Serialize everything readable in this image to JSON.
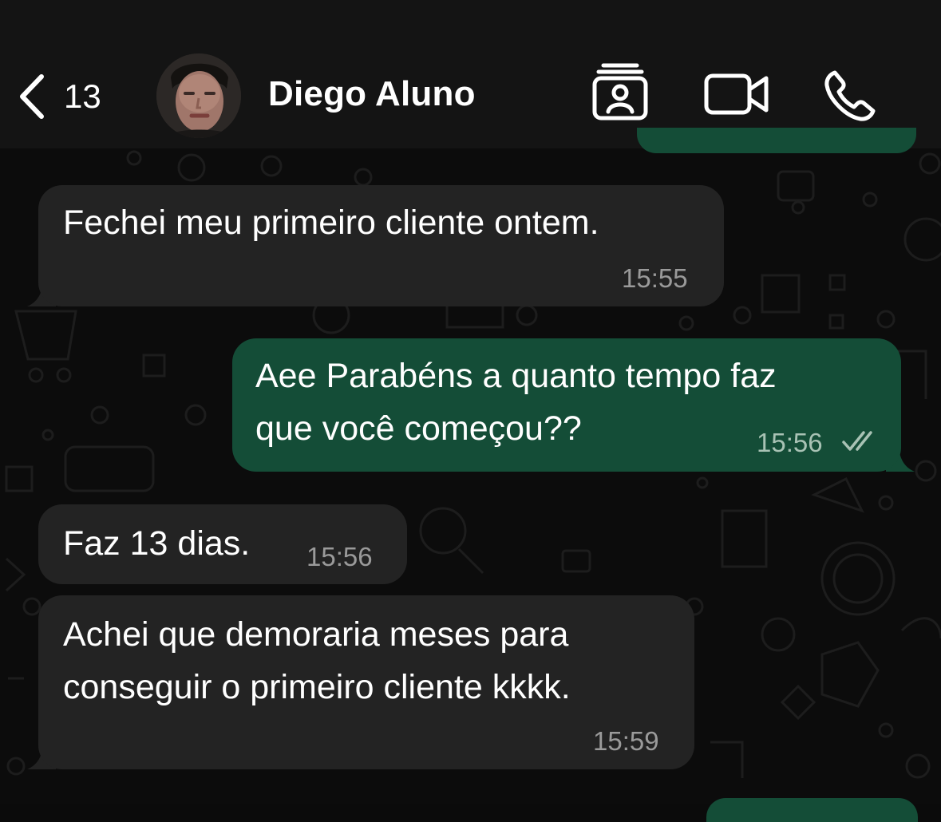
{
  "header": {
    "back_count": "13",
    "contact_name": "Diego Aluno"
  },
  "messages": [
    {
      "direction": "in",
      "text": "Fechei meu primeiro cliente ontem.",
      "time": "15:55"
    },
    {
      "direction": "out",
      "text": "Aee Parabéns a quanto tempo faz\nque você começou??",
      "time": "15:56",
      "status": "read"
    },
    {
      "direction": "in",
      "text": "Faz 13 dias.",
      "time": "15:56"
    },
    {
      "direction": "in",
      "text": "Achei que demoraria meses para\nconseguir o primeiro cliente kkkk.",
      "time": "15:59"
    }
  ],
  "icons": {
    "back": "chevron-left-icon",
    "contact_card": "contact-card-icon",
    "video": "video-camera-icon",
    "phone": "phone-icon",
    "read_receipt": "double-check-icon"
  },
  "colors": {
    "header_bg": "#141414",
    "incoming_bubble": "#232323",
    "outgoing_bubble": "#144d37",
    "timestamp": "#9a9a9a",
    "read_check": "#a8c2b4"
  }
}
